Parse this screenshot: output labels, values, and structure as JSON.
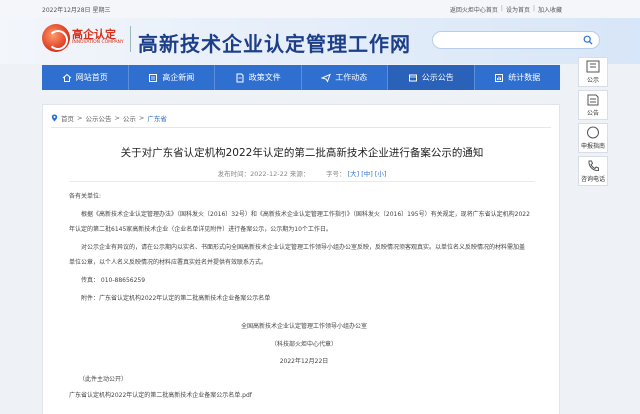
{
  "topbar": {
    "date": "2022年12月28日 星期三",
    "links": [
      "返回火炬中心首页",
      "设为首页",
      "加入收藏"
    ]
  },
  "header": {
    "logo_cn": "高企认定",
    "logo_en": "INNOVATION COMPANY",
    "title": "高新技术企业认定管理工作网",
    "search_placeholder": ""
  },
  "nav": {
    "items": [
      {
        "label": "网站首页",
        "icon": "home-icon"
      },
      {
        "label": "高企新闻",
        "icon": "news-icon"
      },
      {
        "label": "政策文件",
        "icon": "document-icon"
      },
      {
        "label": "工作动态",
        "icon": "plane-icon"
      },
      {
        "label": "公示公告",
        "icon": "notice-icon"
      },
      {
        "label": "统计数据",
        "icon": "stats-icon"
      }
    ]
  },
  "side": {
    "items": [
      {
        "label": "公示",
        "icon": "notice-icon"
      },
      {
        "label": "公告",
        "icon": "announce-icon"
      },
      {
        "label": "申报指南",
        "icon": "compass-icon"
      },
      {
        "label": "咨询电话",
        "icon": "phone-icon"
      }
    ]
  },
  "breadcrumb": {
    "items": [
      "首页",
      "公示公告",
      "公示"
    ],
    "current": "广东省",
    "sep": ">"
  },
  "article": {
    "title": "关于对广东省认定机构2022年认定的第二批高新技术企业进行备案公示的通知",
    "meta_date": "发布时间：2022-12-22 来源：",
    "meta_fontsize": "字号：",
    "font_sizes": [
      "[大]",
      "[中]",
      "[小]"
    ],
    "salutation": "各有关单位:",
    "para1_line1": "根据《高新技术企业认定管理办法》（国科发火〔2016〕32号）和《高新技术企业认定管理工作指引》（国科发火〔2016〕195号）有关规定，现将广东省认定机构2022",
    "para1_line2": "年认定的第二批6145家高新技术企业（企业名单详见附件）进行备案公示，公示期为10个工作日。",
    "para2_line1": "对公示企业有异议的，请在公示期内以实名、书面形式向全国高新技术企业认定管理工作领导小组办公室反映，反映情况须客观真实。以单位名义反映情况的材料需加盖",
    "para2_line2": "单位公章，以个人名义反映情况的材料应署真实姓名并提供有效联系方式。",
    "fax": "传真：  010-88656259",
    "attachment": "附件：广东省认定机构2022年认定的第二批高新技术企业备案公示名单",
    "sign_org": "全国高新技术企业认定管理工作领导小组办公室",
    "sign_sub": "（科技部火炬中心代章）",
    "sign_date": "2022年12月22日",
    "public": "（此件主动公开）",
    "file_link": "广东省认定机构2022年认定的第二批高新技术企业备案公示名单.pdf"
  }
}
